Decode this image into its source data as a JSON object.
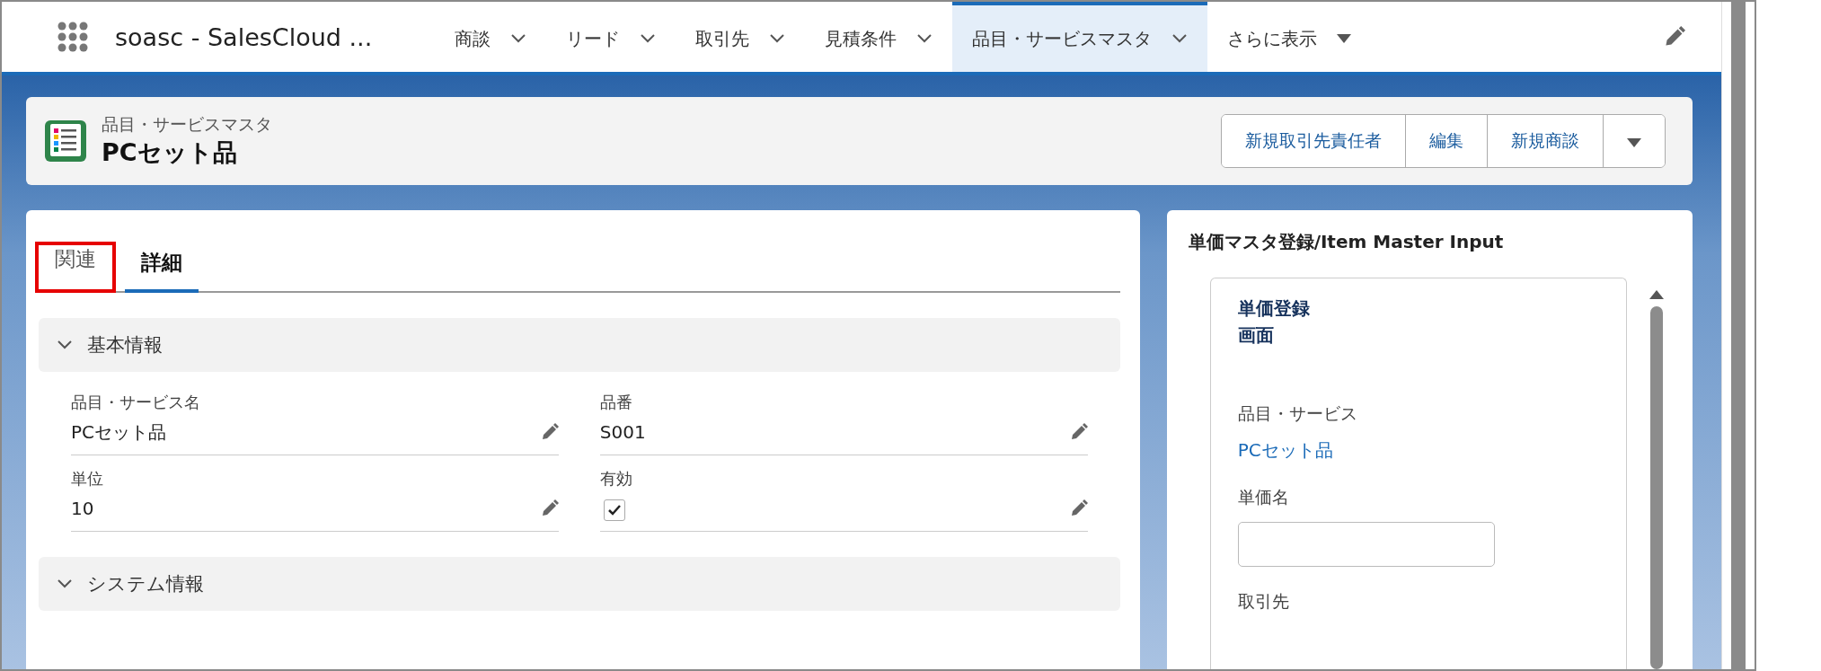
{
  "app_name": "soasc - SalesCloud ...",
  "nav_items": [
    {
      "label": "商談",
      "kind": "menu",
      "selected": false
    },
    {
      "label": "リード",
      "kind": "menu",
      "selected": false
    },
    {
      "label": "取引先",
      "kind": "menu",
      "selected": false
    },
    {
      "label": "見積条件",
      "kind": "menu",
      "selected": false
    },
    {
      "label": "品目・サービスマスタ",
      "kind": "menu",
      "selected": true
    },
    {
      "label": "さらに表示",
      "kind": "more",
      "selected": false
    }
  ],
  "record": {
    "object_label": "品目・サービスマスタ",
    "name": "PCセット品",
    "actions": [
      "新規取引先責任者",
      "編集",
      "新規商談"
    ]
  },
  "tabs": [
    {
      "label": "関連",
      "selected": false,
      "highlighted": true
    },
    {
      "label": "詳細",
      "selected": true,
      "highlighted": false
    }
  ],
  "sections": [
    {
      "title": "基本情報",
      "expanded": true,
      "fields": [
        {
          "label": "品目・サービス名",
          "kind": "text",
          "value": "PCセット品"
        },
        {
          "label": "品番",
          "kind": "text",
          "value": "S001"
        },
        {
          "label": "単位",
          "kind": "text",
          "value": "10"
        },
        {
          "label": "有効",
          "kind": "checkbox",
          "checked": true
        }
      ]
    },
    {
      "title": "システム情報",
      "expanded": true
    }
  ],
  "side_panel": {
    "title": "単価マスタ登録/Item Master Input",
    "form": {
      "heading": [
        "単価登録",
        "画面"
      ],
      "fields": [
        {
          "label": "品目・サービス",
          "kind": "link",
          "value": "PCセット品"
        },
        {
          "label": "単価名",
          "kind": "input"
        },
        {
          "label": "取引先",
          "kind": "label"
        }
      ]
    }
  }
}
